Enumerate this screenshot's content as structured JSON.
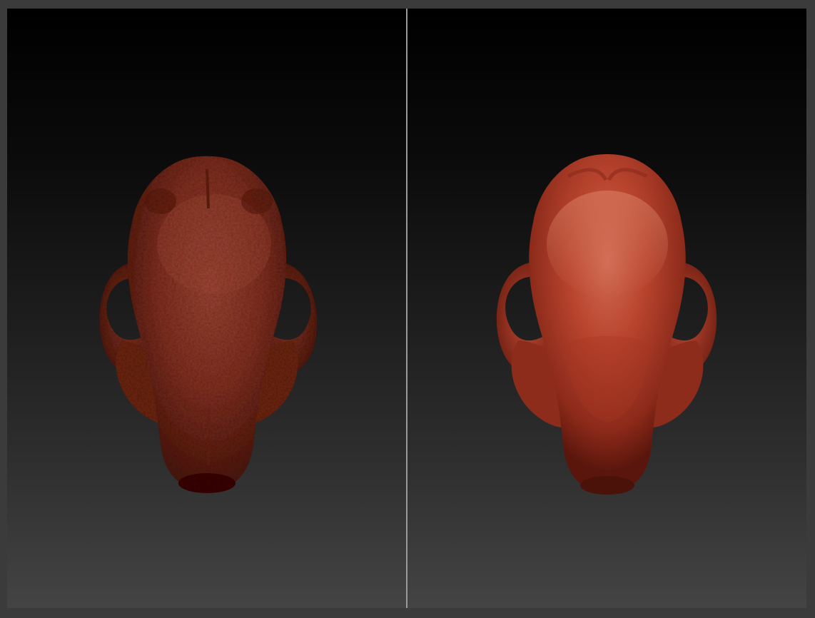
{
  "viewports": [
    {
      "name": "left",
      "model": "skull-textured",
      "surface": "rough",
      "color": "#8a3628"
    },
    {
      "name": "right",
      "model": "skull-smooth",
      "surface": "smooth",
      "color": "#b3402c"
    }
  ],
  "colors": {
    "background_top": "#000000",
    "background_bottom": "#444444",
    "frame": "#3b3b3b",
    "divider": "#9a9a9a"
  }
}
